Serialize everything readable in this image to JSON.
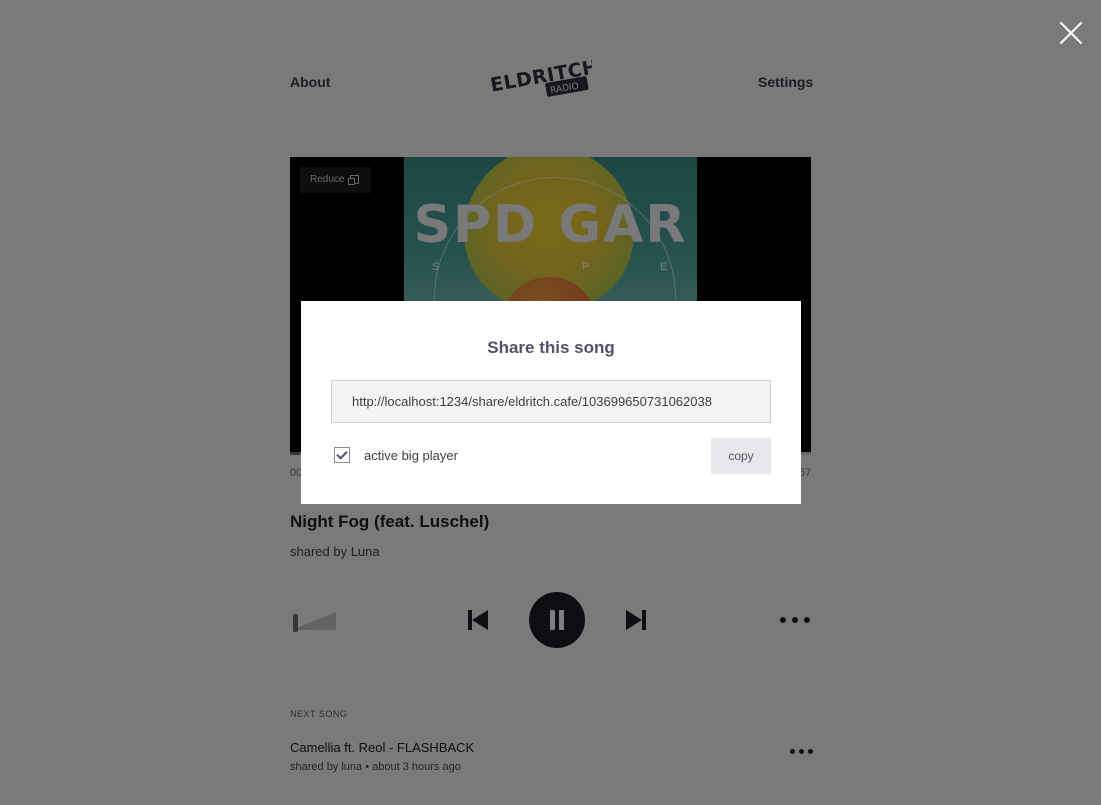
{
  "nav": {
    "about": "About",
    "settings": "Settings",
    "logo_main": "ELDRITCH",
    "logo_sub": "RADIO"
  },
  "player": {
    "reduce_label": "Reduce",
    "artwork_text": "SPD GAR",
    "artwork_letter_left": "S",
    "artwork_letter_mid": "P",
    "artwork_letter_right": "E",
    "time_elapsed": "00",
    "time_total": "57",
    "progress": 0.02
  },
  "song": {
    "title": "Night Fog (feat. Luschel)",
    "shared_by": "shared by Luna"
  },
  "next": {
    "label": "NEXT SONG",
    "title": "Camellia ft. Reol - FLASHBACK",
    "meta": "shared by luna • about 3 hours ago"
  },
  "share_modal": {
    "title": "Share this song",
    "url": "http://localhost:1234/share/eldritch.cafe/103699650731062038",
    "checkbox_label": "active big player",
    "checkbox_checked": true,
    "copy_label": "copy"
  },
  "colors": {
    "accent": "#55506a",
    "dark": "#1d1d2a",
    "overlay": "rgba(0,0,0,0.5)"
  }
}
